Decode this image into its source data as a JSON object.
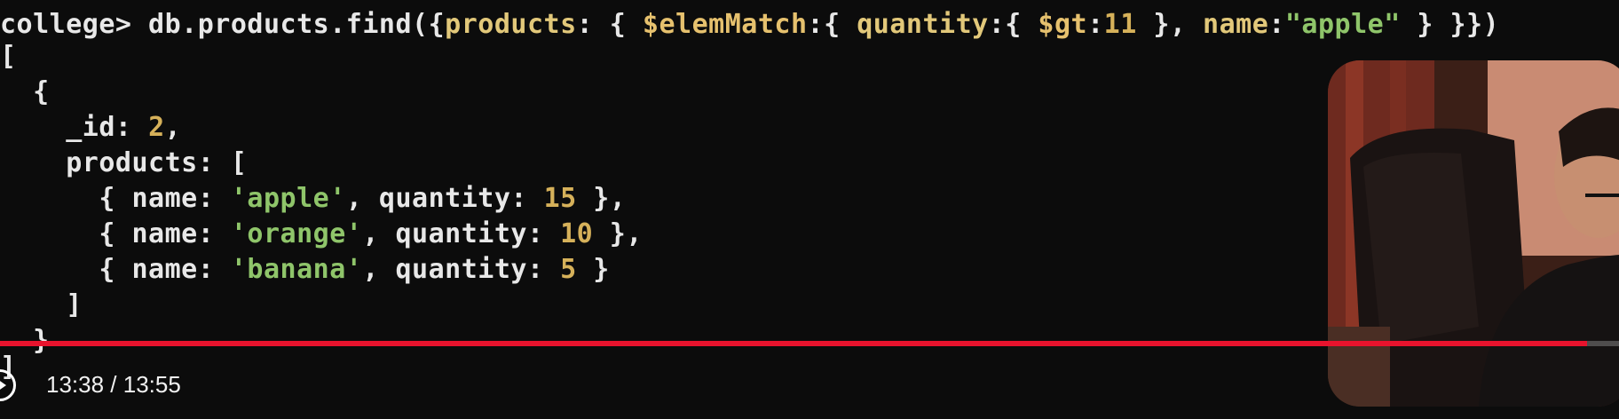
{
  "terminal": {
    "lines": [
      {
        "parts": [
          {
            "t": "college> db.products.find({",
            "c": "plain"
          },
          {
            "t": "products",
            "c": "key"
          },
          {
            "t": ": { ",
            "c": "plain"
          },
          {
            "t": "$elemMatch",
            "c": "op"
          },
          {
            "t": ":{ ",
            "c": "plain"
          },
          {
            "t": "quantity",
            "c": "key"
          },
          {
            "t": ":{ ",
            "c": "plain"
          },
          {
            "t": "$gt",
            "c": "op"
          },
          {
            "t": ":",
            "c": "plain"
          },
          {
            "t": "11",
            "c": "num"
          },
          {
            "t": " }, ",
            "c": "plain"
          },
          {
            "t": "name",
            "c": "key"
          },
          {
            "t": ":",
            "c": "plain"
          },
          {
            "t": "\"apple\"",
            "c": "str"
          },
          {
            "t": " } }})",
            "c": "plain"
          }
        ]
      },
      {
        "parts": [
          {
            "t": "[",
            "c": "plain"
          }
        ]
      },
      {
        "parts": [
          {
            "t": "  {",
            "c": "plain"
          }
        ]
      },
      {
        "parts": [
          {
            "t": "    _id: ",
            "c": "plain"
          },
          {
            "t": "2",
            "c": "num"
          },
          {
            "t": ",",
            "c": "plain"
          }
        ]
      },
      {
        "parts": [
          {
            "t": "    products: [",
            "c": "plain"
          }
        ]
      },
      {
        "parts": [
          {
            "t": "      { name: ",
            "c": "plain"
          },
          {
            "t": "'apple'",
            "c": "str"
          },
          {
            "t": ", quantity: ",
            "c": "plain"
          },
          {
            "t": "15",
            "c": "num"
          },
          {
            "t": " },",
            "c": "plain"
          }
        ]
      },
      {
        "parts": [
          {
            "t": "      { name: ",
            "c": "plain"
          },
          {
            "t": "'orange'",
            "c": "str"
          },
          {
            "t": ", quantity: ",
            "c": "plain"
          },
          {
            "t": "10",
            "c": "num"
          },
          {
            "t": " },",
            "c": "plain"
          }
        ]
      },
      {
        "parts": [
          {
            "t": "      { name: ",
            "c": "plain"
          },
          {
            "t": "'banana'",
            "c": "str"
          },
          {
            "t": ", quantity: ",
            "c": "plain"
          },
          {
            "t": "5",
            "c": "num"
          },
          {
            "t": " }",
            "c": "plain"
          }
        ]
      },
      {
        "parts": [
          {
            "t": "    ]",
            "c": "plain"
          }
        ]
      },
      {
        "parts": [
          {
            "t": "  }",
            "c": "plain"
          }
        ]
      },
      {
        "parts": [
          {
            "t": "]",
            "c": "plain"
          }
        ]
      }
    ]
  },
  "player": {
    "time_label": "13:38 / 13:55",
    "progress_fraction": 0.98,
    "progress_color": "#e8132d",
    "play_icon": "play-icon"
  },
  "webcam": {
    "icon": "presenter-webcam-overlay"
  }
}
